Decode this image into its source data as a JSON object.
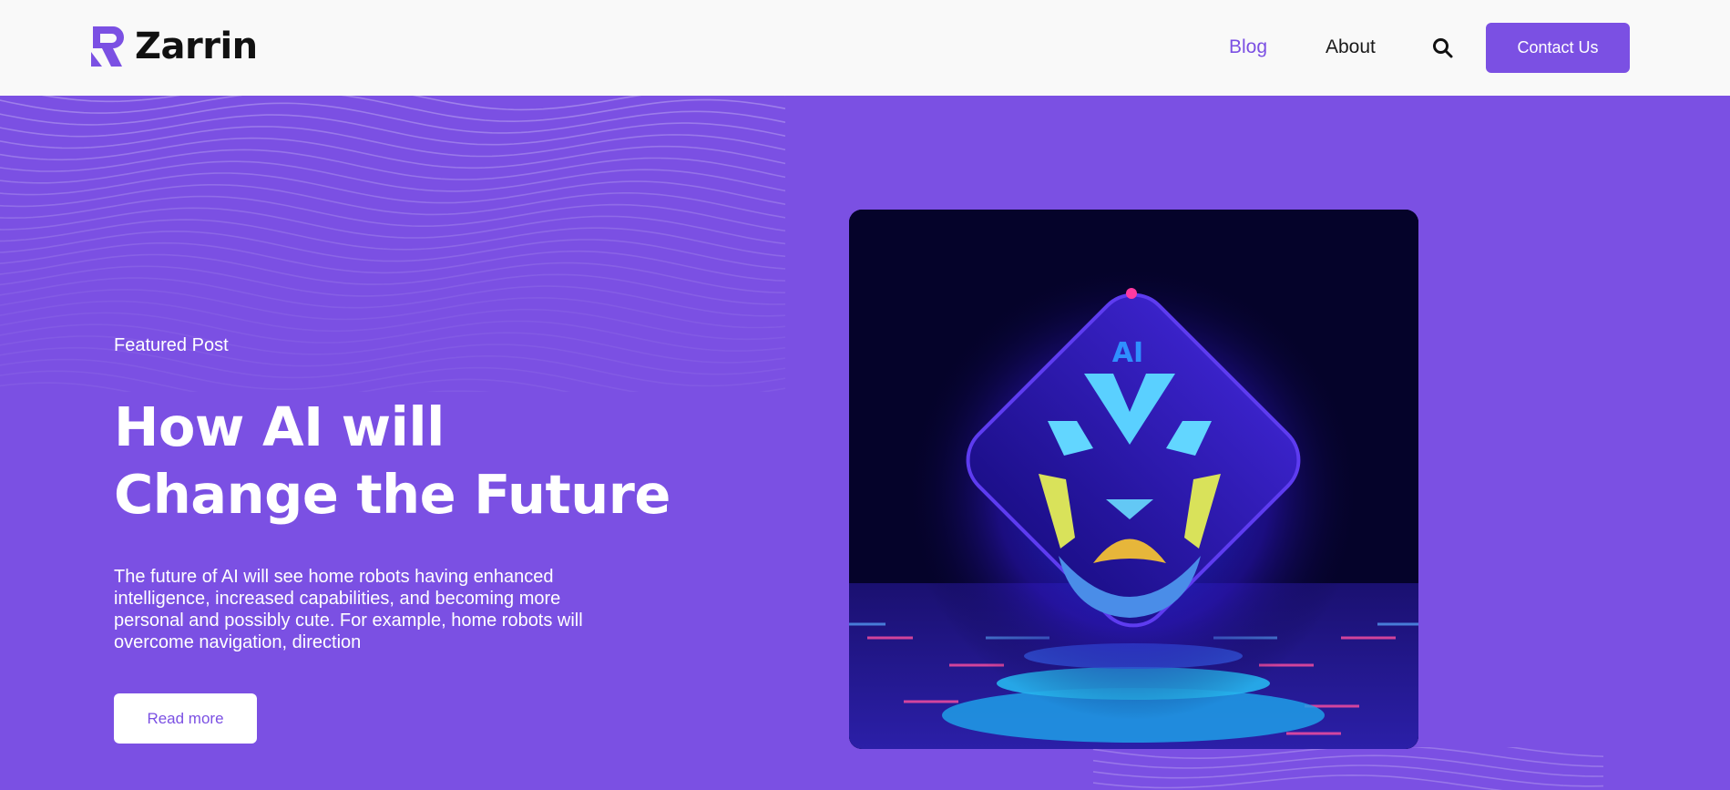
{
  "header": {
    "brand": "Zarrin",
    "nav": {
      "blog": "Blog",
      "about": "About"
    },
    "search_icon": "search-icon",
    "contact_label": "Contact Us"
  },
  "hero": {
    "eyebrow": "Featured Post",
    "title_line1": "How AI will",
    "title_line2": "Change the Future",
    "description": "The future of AI will see home robots having enhanced intelligence, increased capabilities, and becoming more personal and possibly cute. For example, home robots will overcome navigation, direction",
    "read_more_label": "Read more",
    "image_badge": "AI"
  },
  "colors": {
    "accent": "#7b50e3",
    "header_bg": "#f9f9f9",
    "text_dark": "#1a1a1a"
  }
}
